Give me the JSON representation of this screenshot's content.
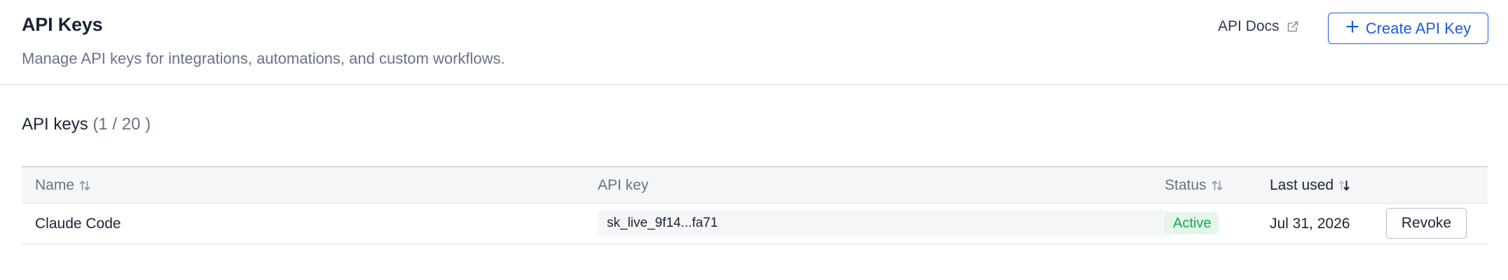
{
  "header": {
    "title": "API Keys",
    "subtitle": "Manage API keys for integrations, automations, and custom workflows.",
    "docs_link": {
      "label": "API Docs",
      "icon": "external-link-icon"
    },
    "create_button": {
      "label": "Create API Key",
      "icon": "plus-icon"
    }
  },
  "section": {
    "title": "API keys",
    "count": "(1 / 20 )"
  },
  "table": {
    "columns": [
      {
        "label": "Name",
        "sortable": true,
        "sort": "none"
      },
      {
        "label": "API key",
        "sortable": false
      },
      {
        "label": "Status",
        "sortable": true,
        "sort": "none"
      },
      {
        "label": "Last used",
        "sortable": true,
        "sort": "descending"
      }
    ],
    "rows": [
      {
        "name": "Claude Code",
        "api_key": "sk_live_9f14...fa71",
        "status": "Active",
        "last_used": "Jul 31, 2026",
        "action": "Revoke"
      }
    ]
  },
  "colors": {
    "accent": "#1f5ae0",
    "status_active_text": "#18a54a",
    "status_active_bg": "#e4f7ea",
    "muted_text": "#687289",
    "primary_text": "#1b2436"
  }
}
